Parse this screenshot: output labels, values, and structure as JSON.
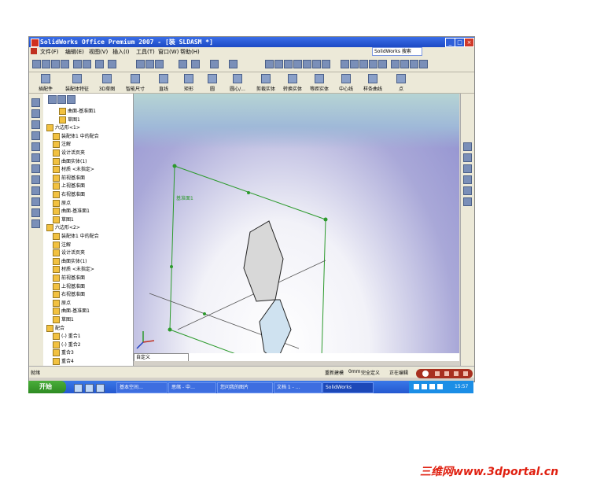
{
  "window": {
    "title": "SolidWorks Office Premium 2007 - [装 SLDASM *]",
    "controls": [
      "_",
      "□",
      "×"
    ]
  },
  "menubar": {
    "items": [
      "文件(F)",
      "编辑(E)",
      "视图(V)",
      "插入(I)",
      "工具(T)",
      "窗口(W)",
      "帮助(H)"
    ],
    "search_label": "SolidWorks 搜索"
  },
  "command_bar": {
    "items": [
      "插配件",
      "装配体特征",
      "3D草图",
      "智能尺寸",
      "直线",
      "矩形",
      "圆",
      "圆心/...",
      "剪裁实体",
      "转换实体",
      "等距实体",
      "中心线",
      "样条曲线",
      "点"
    ]
  },
  "feature_tree": {
    "nodes": [
      {
        "label": "曲面-基准面1",
        "indent": 2
      },
      {
        "label": "草图1",
        "indent": 2
      },
      {
        "label": "六边形<1>",
        "indent": 0
      },
      {
        "label": "装配体1 中的配合",
        "indent": 1
      },
      {
        "label": "注解",
        "indent": 1
      },
      {
        "label": "设计活页夹",
        "indent": 1
      },
      {
        "label": "曲面实体(1)",
        "indent": 1
      },
      {
        "label": "材质 <未指定>",
        "indent": 1
      },
      {
        "label": "前视基准面",
        "indent": 1
      },
      {
        "label": "上视基准面",
        "indent": 1
      },
      {
        "label": "右视基准面",
        "indent": 1
      },
      {
        "label": "原点",
        "indent": 1
      },
      {
        "label": "曲面-基准面1",
        "indent": 1
      },
      {
        "label": "草图1",
        "indent": 1
      },
      {
        "label": "六边形<2>",
        "indent": 0
      },
      {
        "label": "装配体1 中的配合",
        "indent": 1
      },
      {
        "label": "注解",
        "indent": 1
      },
      {
        "label": "设计活页夹",
        "indent": 1
      },
      {
        "label": "曲面实体(1)",
        "indent": 1
      },
      {
        "label": "材质 <未指定>",
        "indent": 1
      },
      {
        "label": "前视基准面",
        "indent": 1
      },
      {
        "label": "上视基准面",
        "indent": 1
      },
      {
        "label": "右视基准面",
        "indent": 1
      },
      {
        "label": "原点",
        "indent": 1
      },
      {
        "label": "曲面-基准面1",
        "indent": 1
      },
      {
        "label": "草图1",
        "indent": 1
      },
      {
        "label": "配合",
        "indent": 0
      },
      {
        "label": "(-) 重合1",
        "indent": 1
      },
      {
        "label": "(-) 重合2",
        "indent": 1
      },
      {
        "label": "重合3",
        "indent": 1
      },
      {
        "label": "重合4",
        "indent": 1
      }
    ]
  },
  "viewport": {
    "plane_label": "基准面1",
    "view_dropdown": "自定义"
  },
  "statusbar": {
    "left": "就绪",
    "status1": "重新建模",
    "status2": "0mm",
    "status3": "完全定义",
    "status4": "正在编辑"
  },
  "taskbar": {
    "start_label": "开始",
    "tasks": [
      "基本空间…",
      "思绪 - 中…",
      "您问我的图片",
      "文档 1 - …",
      "SolidWorks"
    ],
    "clock": "15:57"
  },
  "watermark": "三维网www.3dportal.cn"
}
